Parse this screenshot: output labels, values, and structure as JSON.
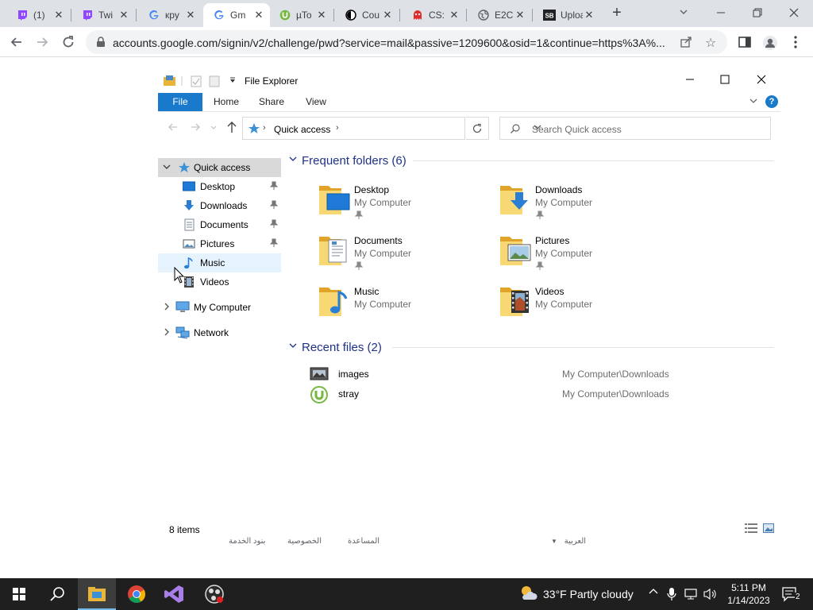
{
  "browser": {
    "tabs": [
      {
        "title": "(1) ",
        "icon": "twitch-icon",
        "color": "#9146ff"
      },
      {
        "title": "Twi",
        "icon": "twitch-icon",
        "color": "#9146ff"
      },
      {
        "title": "крy",
        "icon": "google-icon",
        "color": "#4285f4"
      },
      {
        "title": "Gm",
        "icon": "google-icon",
        "color": "#4285f4",
        "active": true
      },
      {
        "title": "µTo",
        "icon": "utorrent-icon",
        "color": "#76b83f"
      },
      {
        "title": "Cou",
        "icon": "coursera-icon",
        "color": "#000000"
      },
      {
        "title": "CS:",
        "icon": "ghost-icon",
        "color": "#e02a2a"
      },
      {
        "title": "E2C",
        "icon": "globe-icon",
        "color": "#5f6368"
      },
      {
        "title": "Upload",
        "icon": "sb-icon",
        "color": "#202124"
      }
    ],
    "new_tab": "+",
    "url": "accounts.google.com/signin/v2/challenge/pwd?service=mail&passive=1209600&osid=1&continue=https%3A%..."
  },
  "explorer": {
    "title": "File Explorer",
    "ribbon_tabs": [
      "File",
      "Home",
      "Share",
      "View"
    ],
    "breadcrumb": "Quick access",
    "search_placeholder": "Search Quick access",
    "nav": {
      "quick_access": "Quick access",
      "pinned": [
        "Desktop",
        "Downloads",
        "Documents",
        "Pictures"
      ],
      "unpinned": [
        "Music",
        "Videos"
      ],
      "my_computer": "My Computer",
      "network": "Network"
    },
    "frequent_header": "Frequent folders (6)",
    "frequent": [
      {
        "name": "Desktop",
        "location": "My Computer",
        "pinned": true,
        "icon": "desktop-folder-icon"
      },
      {
        "name": "Downloads",
        "location": "My Computer",
        "pinned": true,
        "icon": "downloads-folder-icon"
      },
      {
        "name": "Documents",
        "location": "My Computer",
        "pinned": true,
        "icon": "documents-folder-icon"
      },
      {
        "name": "Pictures",
        "location": "My Computer",
        "pinned": true,
        "icon": "pictures-folder-icon"
      },
      {
        "name": "Music",
        "location": "My Computer",
        "pinned": false,
        "icon": "music-folder-icon"
      },
      {
        "name": "Videos",
        "location": "My Computer",
        "pinned": false,
        "icon": "videos-folder-icon"
      }
    ],
    "recent_header": "Recent files (2)",
    "recent": [
      {
        "name": "images",
        "path": "My Computer\\Downloads",
        "icon": "image-file-icon"
      },
      {
        "name": "stray",
        "path": "My Computer\\Downloads",
        "icon": "utorrent-file-icon"
      }
    ],
    "status": "8 items"
  },
  "google_footer": {
    "language": "العربية",
    "links": [
      "بنود الخدمة",
      "الخصوصية",
      "المساعدة"
    ]
  },
  "taskbar": {
    "weather": "33°F  Partly cloudy",
    "time": "5:11 PM",
    "date": "1/14/2023",
    "notifications": "2"
  }
}
